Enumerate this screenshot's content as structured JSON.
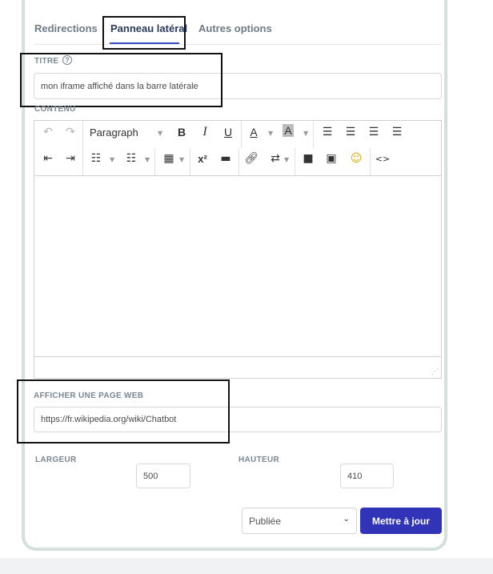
{
  "tabs": [
    {
      "label": "Redirections",
      "active": false
    },
    {
      "label": "Panneau latéral",
      "active": true
    },
    {
      "label": "Autres options",
      "active": false
    }
  ],
  "title_field": {
    "label": "TITRE",
    "help_icon": "question-circle-icon",
    "value": "mon iframe affiché dans la barre latérale"
  },
  "content_field": {
    "label": "CONTENU",
    "toolbar": {
      "format_select": "Paragraph",
      "buttons": {
        "bold": "B",
        "italic": "I",
        "underline": "U",
        "text_color": "A",
        "bg_color": "A",
        "superscript": "x²"
      }
    }
  },
  "webpage_field": {
    "label": "AFFICHER UNE PAGE WEB",
    "value": "https://fr.wikipedia.org/wiki/Chatbot"
  },
  "width_field": {
    "label": "LARGEUR",
    "value": "500"
  },
  "height_field": {
    "label": "HAUTEUR",
    "value": "410"
  },
  "status_select": {
    "value": "Publiée"
  },
  "update_button": {
    "label": "Mettre à jour"
  },
  "colors": {
    "accent": "#3234b8",
    "tab_underline": "#3a4bc4",
    "card_border": "#d3e0dc"
  }
}
